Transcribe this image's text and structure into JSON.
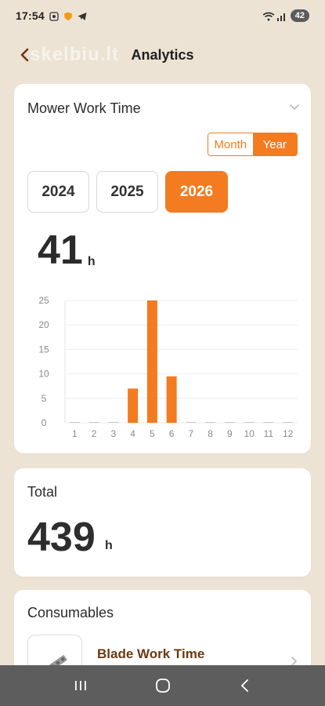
{
  "status_bar": {
    "time": "17:54",
    "battery": "42",
    "icons": [
      "screenshot-icon",
      "shield-badge-icon",
      "telegram-icon",
      "wifi-icon",
      "signal-icon"
    ]
  },
  "app_bar": {
    "title": "Analytics",
    "watermark": "skelbiu.lt",
    "back_icon": "chevron-left-icon",
    "accent": "#f47b20"
  },
  "mower_card": {
    "title": "Mower Work Time",
    "toggle": {
      "month_label": "Month",
      "year_label": "Year",
      "selected": "Year"
    },
    "years": [
      "2024",
      "2025",
      "2026"
    ],
    "selected_year": "2026",
    "hours_value": "41",
    "hours_unit": "h"
  },
  "chart_data": {
    "type": "bar",
    "categories": [
      "1",
      "2",
      "3",
      "4",
      "5",
      "6",
      "7",
      "8",
      "9",
      "10",
      "11",
      "12"
    ],
    "values": [
      0,
      0,
      0,
      7,
      25,
      9.5,
      0,
      0,
      0,
      0,
      0,
      0
    ],
    "yticks": [
      "0",
      "5",
      "10",
      "15",
      "20",
      "25"
    ],
    "ylim": [
      0,
      25
    ],
    "grid": true,
    "bar_color": "#f47b20"
  },
  "total_card": {
    "title": "Total",
    "value": "439",
    "unit": "h"
  },
  "consumables_card": {
    "title": "Consumables",
    "item_label": "Blade Work Time"
  }
}
